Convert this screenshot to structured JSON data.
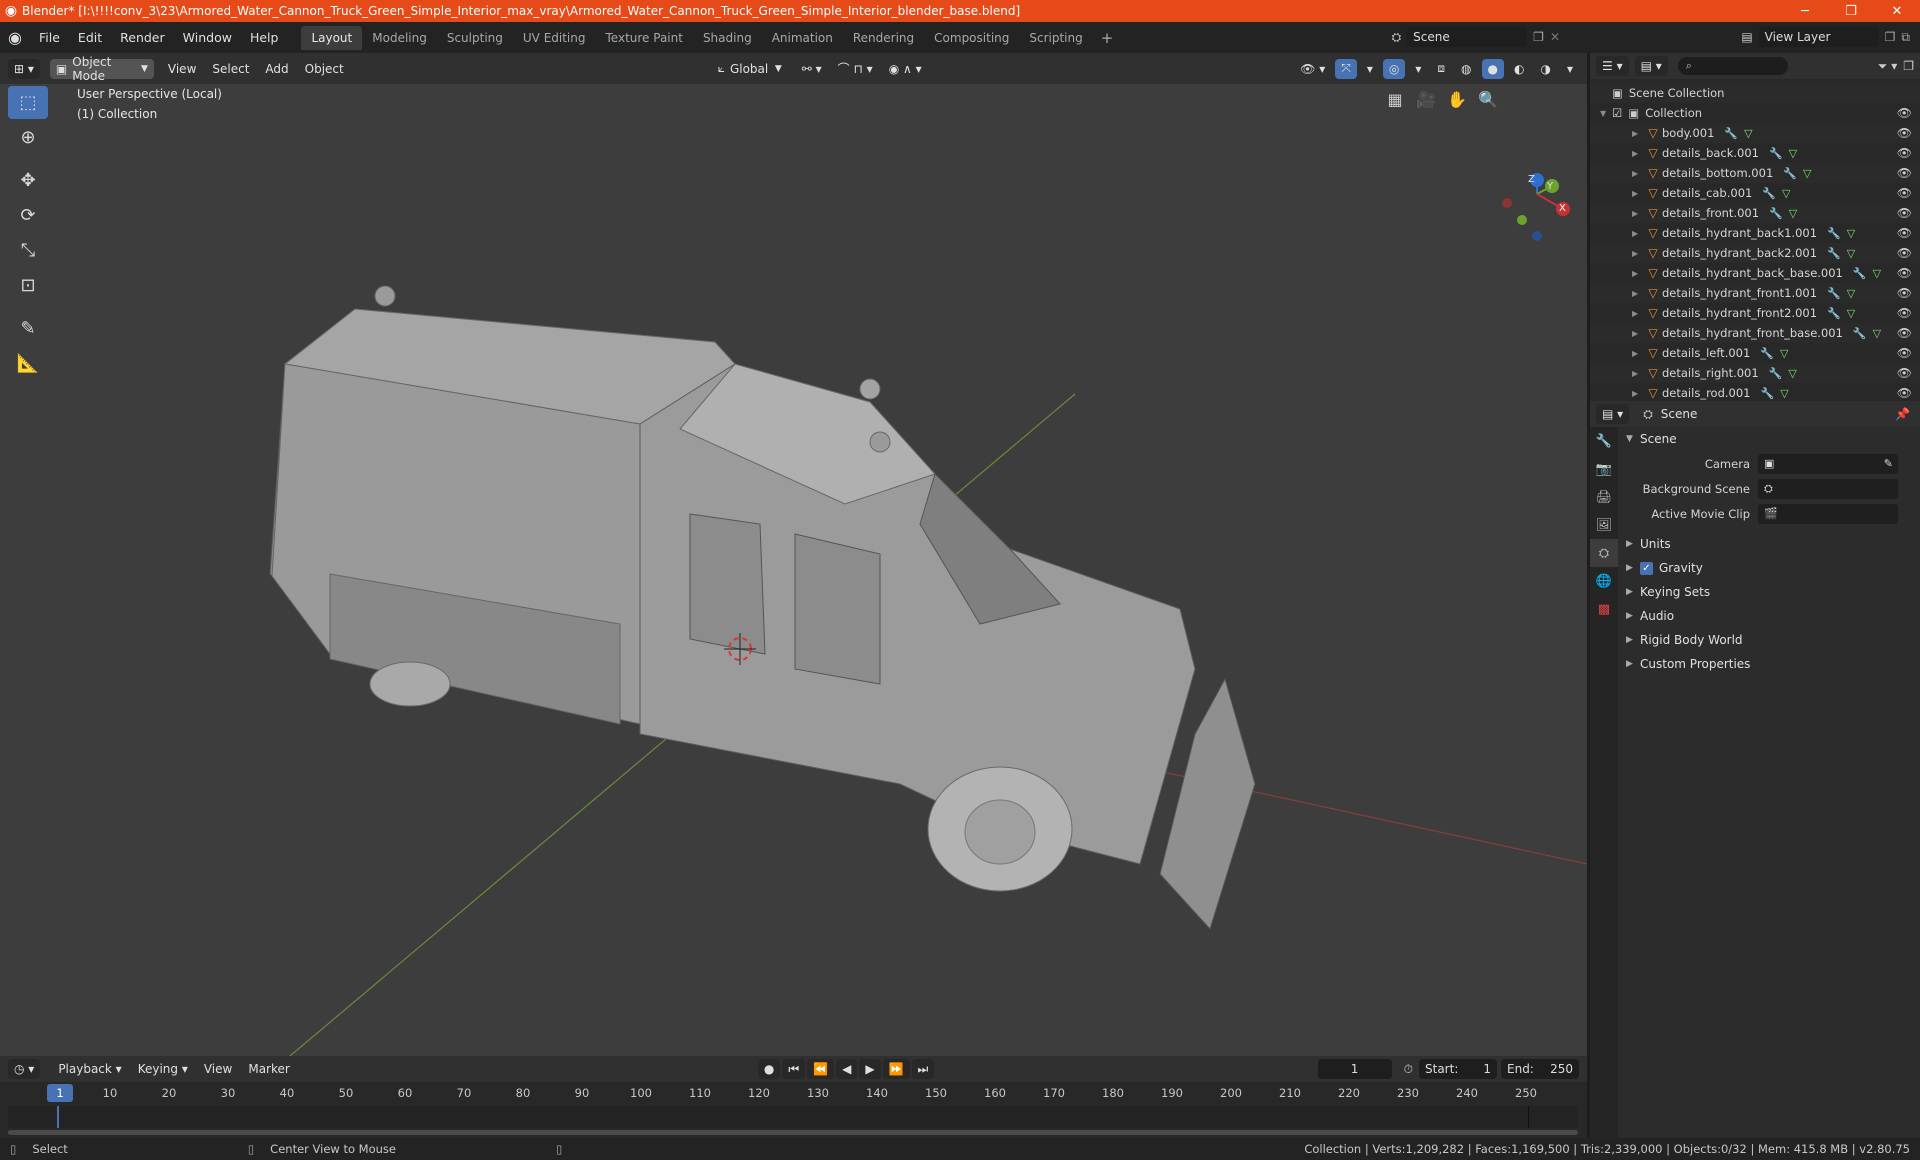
{
  "window": {
    "title": "Blender* [I:\\!!!!conv_3\\23\\Armored_Water_Cannon_Truck_Green_Simple_Interior_max_vray\\Armored_Water_Cannon_Truck_Green_Simple_Interior_blender_base.blend]"
  },
  "menu": {
    "items": [
      "File",
      "Edit",
      "Render",
      "Window",
      "Help"
    ]
  },
  "workspaces": [
    "Layout",
    "Modeling",
    "Sculpting",
    "UV Editing",
    "Texture Paint",
    "Shading",
    "Animation",
    "Rendering",
    "Compositing",
    "Scripting"
  ],
  "scene_name": "Scene",
  "view_layer": "View Layer",
  "viewport_header": {
    "mode": "Object Mode",
    "menus": [
      "View",
      "Select",
      "Add",
      "Object"
    ],
    "orientation": "Global"
  },
  "viewport": {
    "perspective": "User Perspective (Local)",
    "collection": "(1) Collection",
    "gizmo_axes": [
      "Z",
      "Y",
      "X"
    ]
  },
  "outliner": {
    "root": "Scene Collection",
    "collection": "Collection",
    "objects": [
      "body.001",
      "details_back.001",
      "details_bottom.001",
      "details_cab.001",
      "details_front.001",
      "details_hydrant_back1.001",
      "details_hydrant_back2.001",
      "details_hydrant_back_base.001",
      "details_hydrant_front1.001",
      "details_hydrant_front2.001",
      "details_hydrant_front_base.001",
      "details_left.001",
      "details_right.001",
      "details_rod.001"
    ]
  },
  "properties": {
    "context": "Scene",
    "panel_title": "Scene",
    "camera_label": "Camera",
    "background_scene_label": "Background Scene",
    "active_movie_clip_label": "Active Movie Clip",
    "subpanels": [
      "Units",
      "Gravity",
      "Keying Sets",
      "Audio",
      "Rigid Body World",
      "Custom Properties"
    ]
  },
  "timeline": {
    "menus": [
      "Playback",
      "Keying",
      "View",
      "Marker"
    ],
    "current_frame": "1",
    "start_label": "Start:",
    "start": "1",
    "end_label": "End:",
    "end": "250",
    "ticks": [
      "10",
      "20",
      "30",
      "40",
      "50",
      "60",
      "70",
      "80",
      "90",
      "100",
      "110",
      "120",
      "130",
      "140",
      "150",
      "160",
      "170",
      "180",
      "190",
      "200",
      "210",
      "220",
      "230",
      "240",
      "250"
    ],
    "cursor_label": "1"
  },
  "statusbar": {
    "select": "Select",
    "center_view": "Center View to Mouse",
    "stats": "Collection | Verts:1,209,282 | Faces:1,169,500 | Tris:2,339,000 | Objects:0/32 | Mem: 415.8 MB | v2.80.75"
  },
  "colors": {
    "accent": "#4772b3",
    "titlebar": "#e64a19",
    "object_icon": "#e8922e",
    "modifier_icon": "#6fa6e6",
    "mesh_icon": "#7ae06c"
  }
}
